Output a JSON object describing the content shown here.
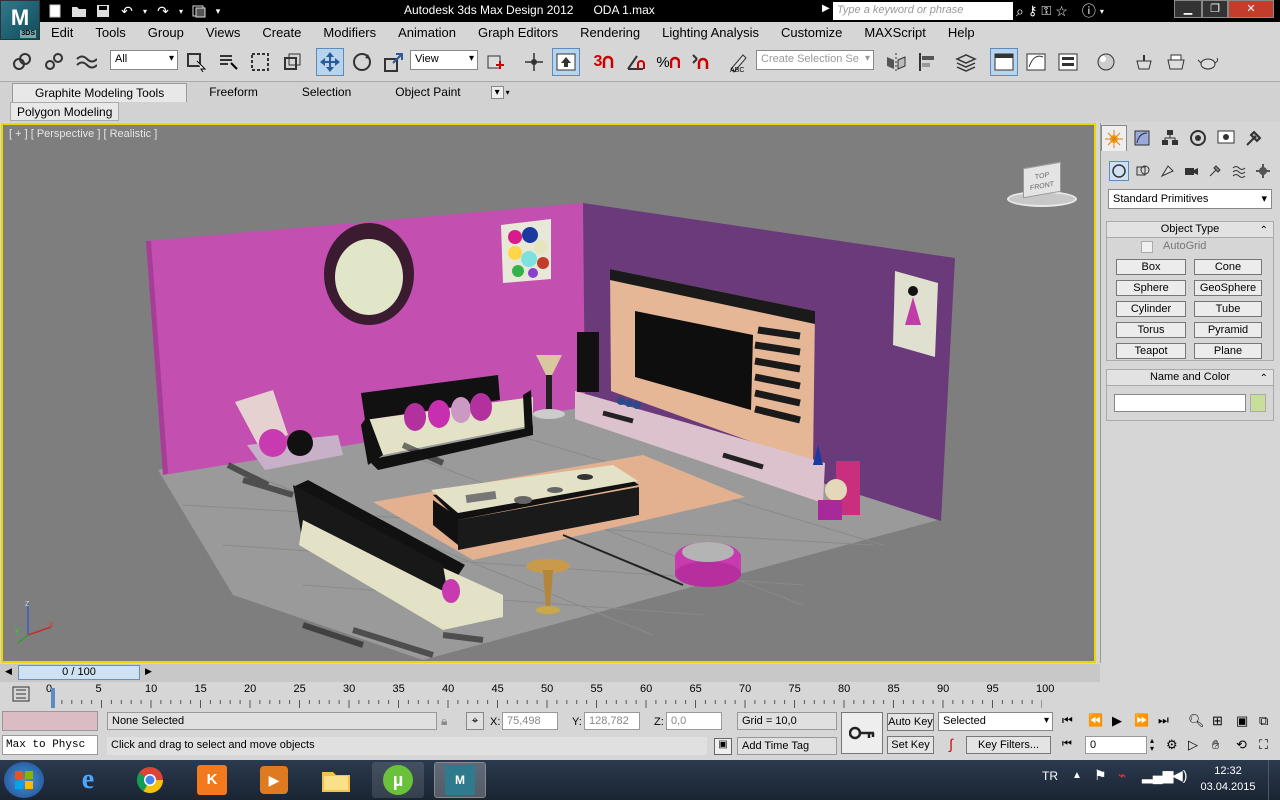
{
  "title": {
    "app": "Autodesk 3ds Max Design 2012",
    "file": "ODA 1.max",
    "logo_text": "M",
    "logo_badge": "3DS",
    "search_placeholder": "Type a keyword or phrase"
  },
  "menu": [
    "Edit",
    "Tools",
    "Group",
    "Views",
    "Create",
    "Modifiers",
    "Animation",
    "Graph Editors",
    "Rendering",
    "Lighting Analysis",
    "Customize",
    "MAXScript",
    "Help"
  ],
  "toolbar": {
    "selection_filter": "All",
    "ref_coord": "View",
    "named_selection_placeholder": "Create Selection Se"
  },
  "ribbon": {
    "tabs": [
      "Graphite Modeling Tools",
      "Freeform",
      "Selection",
      "Object Paint"
    ],
    "panel": "Polygon Modeling"
  },
  "viewport": {
    "label": "[ + ] [ Perspective ] [ Realistic ]",
    "viewcube": {
      "top": "TOP",
      "front": "FRONT"
    },
    "axis": {
      "x": "x",
      "y": "y",
      "z": "z"
    }
  },
  "command_panel": {
    "primitive_type": "Standard Primitives",
    "object_type_title": "Object Type",
    "autogrid": "AutoGrid",
    "buttons": [
      "Box",
      "Cone",
      "Sphere",
      "GeoSphere",
      "Cylinder",
      "Tube",
      "Torus",
      "Pyramid",
      "Teapot",
      "Plane"
    ],
    "name_color_title": "Name and Color",
    "name_value": "",
    "swatch_color": "#c8df9a"
  },
  "timeline": {
    "frame_display": "0 / 100",
    "ticks": [
      "0",
      "5",
      "10",
      "15",
      "20",
      "25",
      "30",
      "35",
      "40",
      "45",
      "50",
      "55",
      "60",
      "65",
      "70",
      "75",
      "80",
      "85",
      "90",
      "95",
      "100"
    ]
  },
  "status": {
    "script_listener": "Max to Physc",
    "selection_state": "None Selected",
    "prompt": "Click and drag to select and move objects",
    "x_label": "X:",
    "x_value": "75,498",
    "y_label": "Y:",
    "y_value": "128,782",
    "z_label": "Z:",
    "z_value": "0,0",
    "grid": "Grid = 10,0",
    "add_time_tag": "Add Time Tag",
    "auto_key": "Auto Key",
    "set_key": "Set Key",
    "key_mode": "Selected",
    "key_filters": "Key Filters...",
    "current_frame": "0"
  },
  "taskbar": {
    "lang": "TR",
    "time": "12:32",
    "date": "03.04.2015"
  },
  "colors": {
    "viewport_bg": "#7e7e7e",
    "active_border": "#e9d800",
    "wall_left": "#c34fb0",
    "wall_right": "#6a3a7a",
    "accent": "#cc33aa"
  }
}
